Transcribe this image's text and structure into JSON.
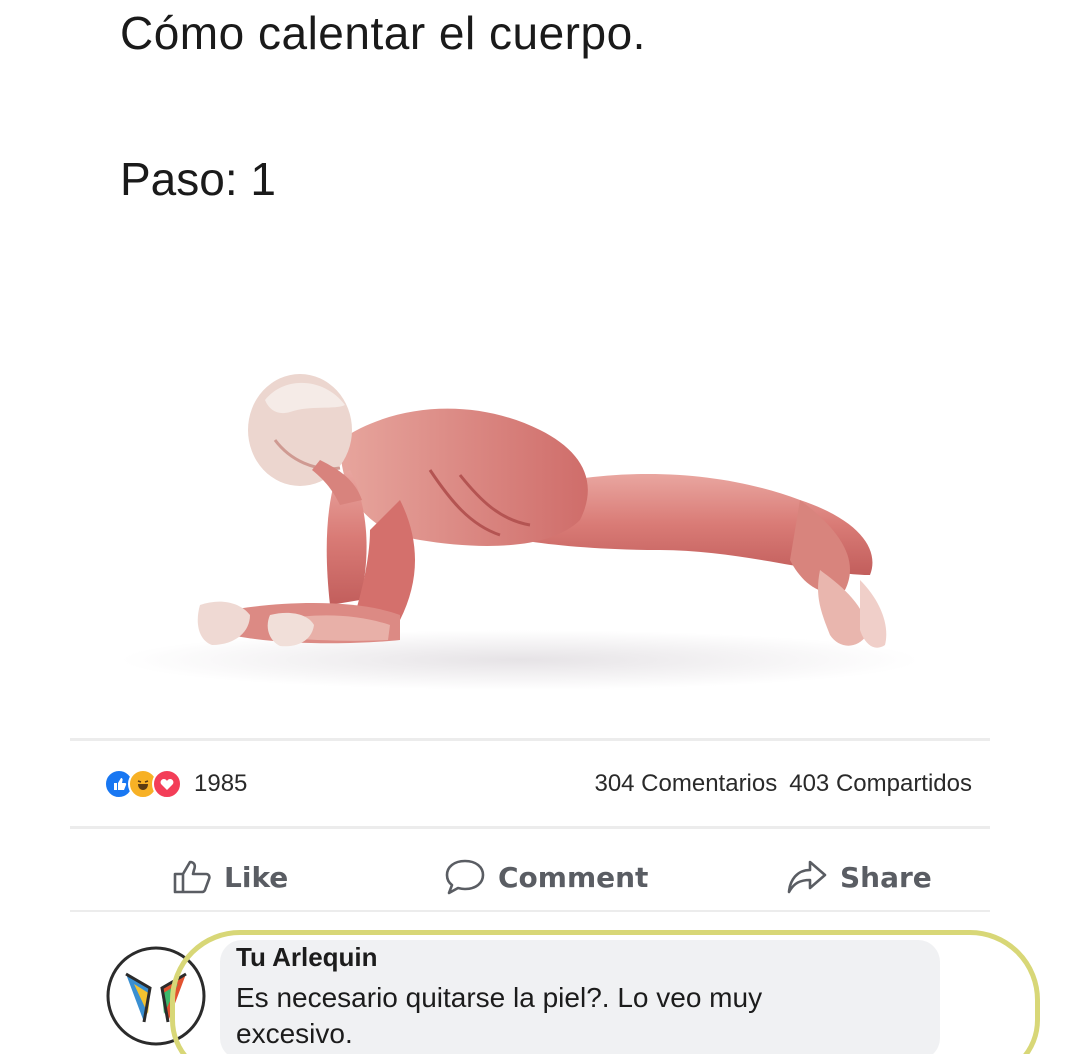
{
  "post": {
    "title": "Cómo calentar el cuerpo.",
    "step": "Paso: 1"
  },
  "reactions": {
    "icons": [
      "like-icon",
      "haha-icon",
      "love-icon"
    ],
    "count": "1985",
    "comments": "304 Comentarios",
    "shares": "403 Compartidos",
    "colors": {
      "like": "#1877f2",
      "haha": "#f7b125",
      "love": "#f33e58"
    }
  },
  "actions": {
    "like": "Like",
    "comment": "Comment",
    "share": "Share"
  },
  "comment": {
    "author": "Tu Arlequin",
    "text": "Es necesario quitarse la piel?. Lo veo muy excesivo.",
    "highlight_color": "#d8d777"
  }
}
